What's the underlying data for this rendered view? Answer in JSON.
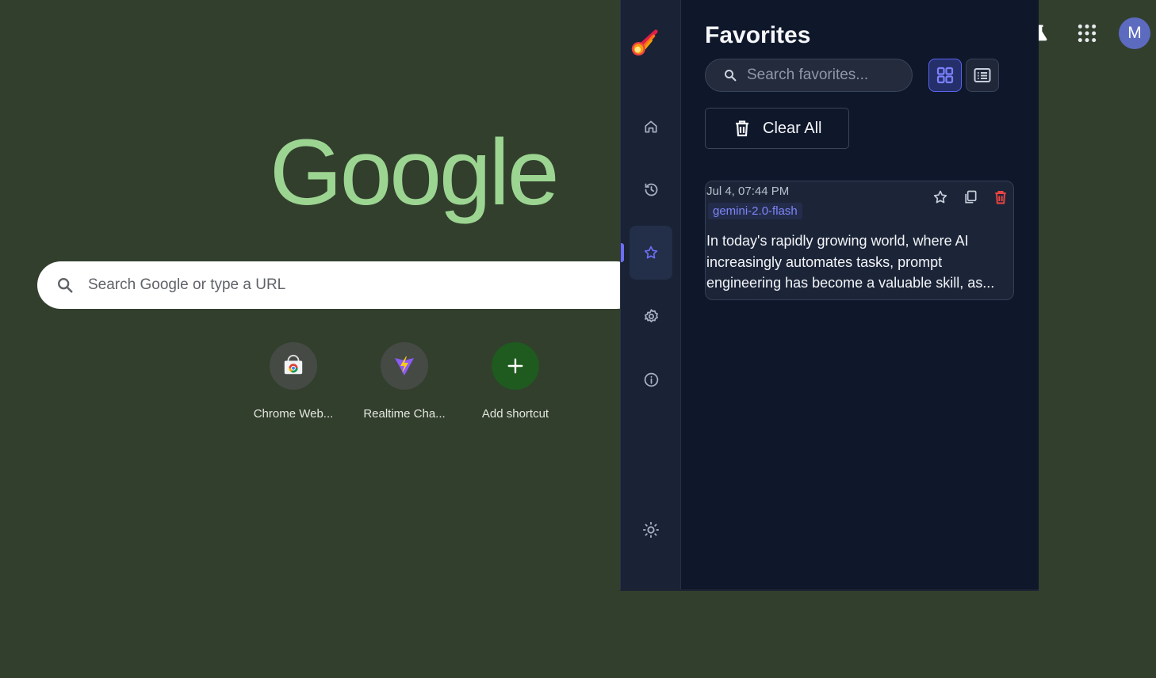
{
  "newtab": {
    "logo_text": "Google",
    "search_placeholder": "Search Google or type a URL",
    "avatar_letter": "M",
    "shortcuts": [
      {
        "label": "Chrome Web...",
        "icon": "chrome-web-store-icon"
      },
      {
        "label": "Realtime Cha...",
        "icon": "vite-icon"
      },
      {
        "label": "Add shortcut",
        "icon": "plus-icon"
      }
    ],
    "icons": [
      "search-icon",
      "labs-flask-icon",
      "apps-grid-icon"
    ]
  },
  "panel": {
    "title": "Favorites",
    "search_placeholder": "Search favorites...",
    "clear_all_label": "Clear All",
    "rail_items": [
      {
        "name": "home",
        "icon": "home-icon"
      },
      {
        "name": "history",
        "icon": "history-icon"
      },
      {
        "name": "favorites",
        "icon": "star-icon",
        "active": true
      },
      {
        "name": "settings",
        "icon": "gear-icon"
      },
      {
        "name": "about",
        "icon": "info-icon"
      },
      {
        "name": "theme",
        "icon": "sun-icon"
      }
    ],
    "favorites": [
      {
        "date": "Jul 4, 07:44 PM",
        "model": "gemini-2.0-flash",
        "text": "In today's rapidly growing world, where AI increasingly automates tasks, prompt engineering has become a valuable skill, as..."
      }
    ],
    "colors": {
      "accent": "#6d6ef5",
      "panel_bg": "#0f172a",
      "delete": "#ef4444"
    }
  }
}
